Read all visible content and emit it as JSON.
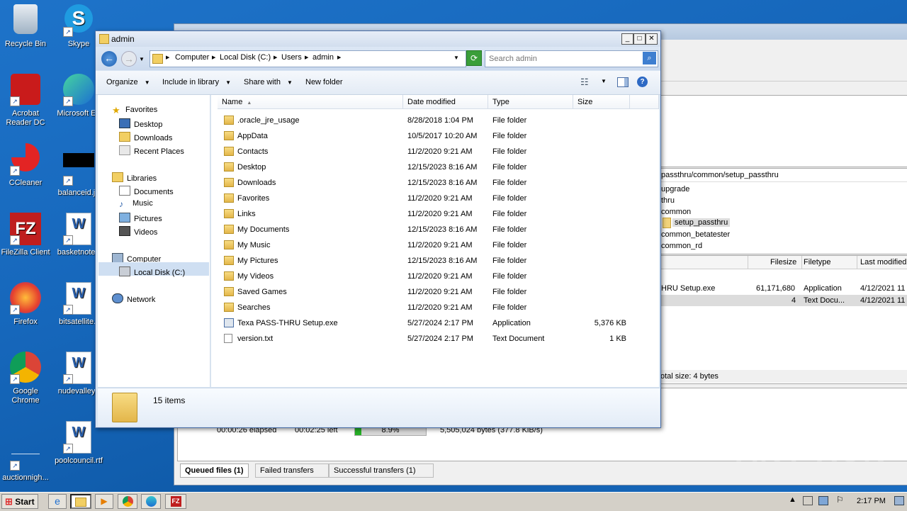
{
  "desktop": {
    "icons": [
      {
        "label": "Recycle Bin",
        "icon": "recycle-bin-icon"
      },
      {
        "label": "Skype",
        "icon": "skype-icon"
      },
      {
        "label": "Acrobat Reader DC",
        "icon": "acrobat-icon"
      },
      {
        "label": "Microsoft Ed",
        "icon": "edge-icon"
      },
      {
        "label": "CCleaner",
        "icon": "ccleaner-icon"
      },
      {
        "label": "balanceid.jp",
        "icon": "image-file-icon"
      },
      {
        "label": "FileZilla Client",
        "icon": "filezilla-icon"
      },
      {
        "label": "basketnote.r",
        "icon": "word-doc-icon"
      },
      {
        "label": "Firefox",
        "icon": "firefox-icon"
      },
      {
        "label": "bitsatellite.r",
        "icon": "word-doc-icon"
      },
      {
        "label": "Google Chrome",
        "icon": "chrome-icon"
      },
      {
        "label": "nudevalley.r",
        "icon": "word-doc-icon"
      },
      {
        "label": "auctionnigh...",
        "icon": "blank-file-icon"
      },
      {
        "label": "poolcouncil.rtf",
        "icon": "word-doc-icon"
      }
    ]
  },
  "filezilla": {
    "remote_path": "passthru/common/setup_passthru",
    "tree": [
      "upgrade",
      "thru",
      "common",
      "setup_passthru",
      "common_betatester",
      "common_rd"
    ],
    "columns": [
      "Filesize",
      "Filetype",
      "Last modified"
    ],
    "files": [
      {
        "name": "HRU Setup.exe",
        "size": "61,171,680",
        "type": "Application",
        "modified": "4/12/2021 11"
      },
      {
        "name": "",
        "size": "4",
        "type": "Text Docu...",
        "modified": "4/12/2021 11"
      }
    ],
    "total": "otal size: 4 bytes",
    "transfer": {
      "elapsed": "00:00:26 elapsed",
      "left": "00:02:25 left",
      "percent": "8.9%",
      "progress": 0.089,
      "bytes": "5,505,024 bytes (377.8 KiB/s)"
    },
    "tabs": [
      "Queued files (1)",
      "Failed transfers",
      "Successful transfers (1)"
    ]
  },
  "explorer": {
    "title": "admin",
    "breadcrumb": [
      "Computer",
      "Local Disk (C:)",
      "Users",
      "admin"
    ],
    "search_placeholder": "Search admin",
    "toolbar": {
      "organize": "Organize",
      "include": "Include in library",
      "share": "Share with",
      "new_folder": "New folder"
    },
    "nav": {
      "favorites": "Favorites",
      "fav_items": [
        "Desktop",
        "Downloads",
        "Recent Places"
      ],
      "libraries": "Libraries",
      "lib_items": [
        "Documents",
        "Music",
        "Pictures",
        "Videos"
      ],
      "computer": "Computer",
      "local_disk": "Local Disk (C:)",
      "network": "Network"
    },
    "columns": {
      "name": "Name",
      "date": "Date modified",
      "type": "Type",
      "size": "Size"
    },
    "rows": [
      {
        "name": ".oracle_jre_usage",
        "date": "8/28/2018 1:04 PM",
        "type": "File folder",
        "size": ""
      },
      {
        "name": "AppData",
        "date": "10/5/2017 10:20 AM",
        "type": "File folder",
        "size": ""
      },
      {
        "name": "Contacts",
        "date": "11/2/2020 9:21 AM",
        "type": "File folder",
        "size": ""
      },
      {
        "name": "Desktop",
        "date": "12/15/2023 8:16 AM",
        "type": "File folder",
        "size": ""
      },
      {
        "name": "Downloads",
        "date": "12/15/2023 8:16 AM",
        "type": "File folder",
        "size": ""
      },
      {
        "name": "Favorites",
        "date": "11/2/2020 9:21 AM",
        "type": "File folder",
        "size": ""
      },
      {
        "name": "Links",
        "date": "11/2/2020 9:21 AM",
        "type": "File folder",
        "size": ""
      },
      {
        "name": "My Documents",
        "date": "12/15/2023 8:16 AM",
        "type": "File folder",
        "size": ""
      },
      {
        "name": "My Music",
        "date": "11/2/2020 9:21 AM",
        "type": "File folder",
        "size": ""
      },
      {
        "name": "My Pictures",
        "date": "12/15/2023 8:16 AM",
        "type": "File folder",
        "size": ""
      },
      {
        "name": "My Videos",
        "date": "11/2/2020 9:21 AM",
        "type": "File folder",
        "size": ""
      },
      {
        "name": "Saved Games",
        "date": "11/2/2020 9:21 AM",
        "type": "File folder",
        "size": ""
      },
      {
        "name": "Searches",
        "date": "11/2/2020 9:21 AM",
        "type": "File folder",
        "size": ""
      },
      {
        "name": "Texa PASS-THRU Setup.exe",
        "date": "5/27/2024 2:17 PM",
        "type": "Application",
        "size": "5,376 KB"
      },
      {
        "name": "version.txt",
        "date": "5/27/2024 2:17 PM",
        "type": "Text Document",
        "size": "1 KB"
      }
    ],
    "item_count": "15 items"
  },
  "taskbar": {
    "start": "Start",
    "clock": "2:17 PM"
  },
  "watermark": "ANY RUN"
}
